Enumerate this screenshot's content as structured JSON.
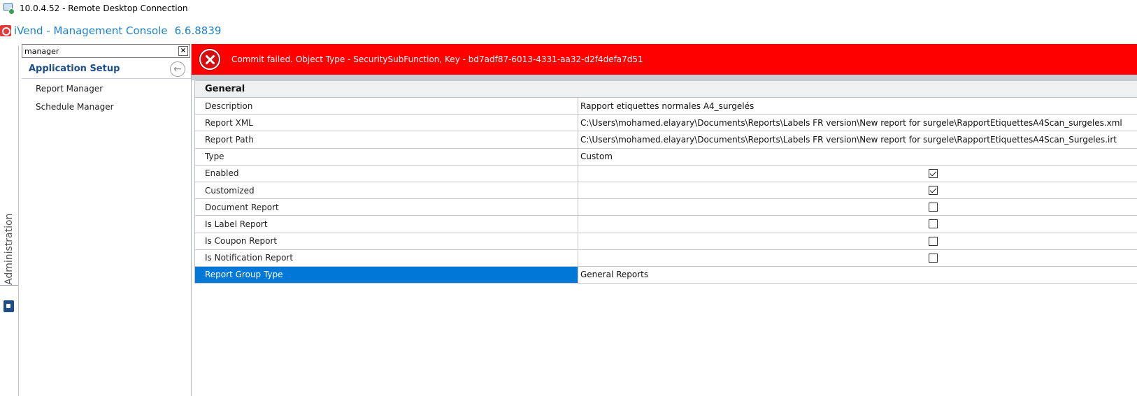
{
  "window": {
    "title": "10.0.4.52 - Remote Desktop Connection"
  },
  "app": {
    "title": "iVend - Management Console",
    "version": "6.6.8839"
  },
  "rail": {
    "label": "Administration"
  },
  "nav": {
    "search_value": "manager",
    "clear_label": "×",
    "header": "Application Setup",
    "items": [
      {
        "label": "Report Manager"
      },
      {
        "label": "Schedule Manager"
      }
    ]
  },
  "error": {
    "message": "Commit failed. Object Type - SecuritySubFunction, Key - bd7adf87-6013-4331-aa32-d2f4defa7d51"
  },
  "grid": {
    "header": "General",
    "rows": [
      {
        "label": "Description",
        "value": "Rapport etiquettes normales A4_surgelés"
      },
      {
        "label": "Report XML",
        "value": "C:\\Users\\mohamed.elayary\\Documents\\Reports\\Labels FR version\\New report for surgele\\RapportEtiquettesA4Scan_surgeles.xml"
      },
      {
        "label": "Report Path",
        "value": "C:\\Users\\mohamed.elayary\\Documents\\Reports\\Labels FR version\\New report for surgele\\RapportEtiquettesA4Scan_Surgeles.irt"
      },
      {
        "label": "Type",
        "value": "Custom"
      },
      {
        "label": "Enabled",
        "checked": true
      },
      {
        "label": "Customized",
        "checked": true
      },
      {
        "label": "Document Report",
        "checked": false
      },
      {
        "label": "Is Label Report",
        "checked": false
      },
      {
        "label": "Is Coupon Report",
        "checked": false
      },
      {
        "label": "Is Notification Report",
        "checked": false
      },
      {
        "label": "Report Group Type",
        "value": "General Reports",
        "selected": true
      }
    ]
  },
  "colors": {
    "accent": "#1e82c8",
    "error": "#fe0000",
    "selection": "#0078d7",
    "nav_title": "#1d4e8a"
  }
}
